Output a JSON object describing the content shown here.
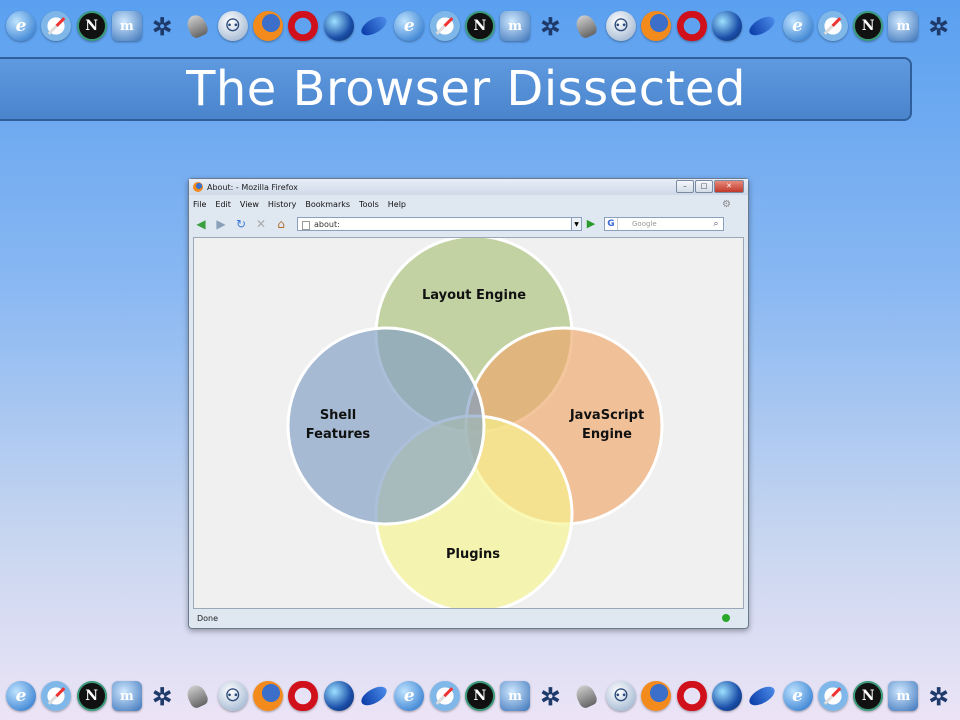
{
  "slide": {
    "title": "The Browser Dissected"
  },
  "icon_strip": {
    "top": [
      "ie-icon",
      "safari-icon",
      "netscape-icon",
      "mozilla-icon",
      "konqueror-icon",
      "ghost-icon",
      "seamonkey-icon",
      "firefox-icon",
      "opera-icon",
      "globe-icon",
      "flock-icon",
      "ie-icon",
      "safari-icon",
      "netscape-icon",
      "mozilla-icon",
      "konqueror-icon",
      "ghost-icon",
      "seamonkey-icon",
      "firefox-icon",
      "opera-icon",
      "globe-icon",
      "flock-icon",
      "ie-icon",
      "safari-icon",
      "netscape-icon",
      "mozilla-icon",
      "konqueror-icon"
    ],
    "bottom": [
      "ie-icon",
      "safari-icon",
      "netscape-icon",
      "mozilla-icon",
      "konqueror-icon",
      "ghost-icon",
      "seamonkey-icon",
      "firefox-icon",
      "opera-icon",
      "globe-icon",
      "flock-icon",
      "ie-icon",
      "safari-icon",
      "netscape-icon",
      "mozilla-icon",
      "konqueror-icon",
      "ghost-icon",
      "seamonkey-icon",
      "firefox-icon",
      "opera-icon",
      "globe-icon",
      "flock-icon",
      "ie-icon",
      "safari-icon",
      "netscape-icon",
      "mozilla-icon",
      "konqueror-icon"
    ]
  },
  "browser": {
    "window_title": "About: - Mozilla Firefox",
    "menu": [
      "File",
      "Edit",
      "View",
      "History",
      "Bookmarks",
      "Tools",
      "Help"
    ],
    "address": "about:",
    "search_placeholder": "Google",
    "search_engine_glyph": "G",
    "status": "Done"
  },
  "diagram": {
    "circles": [
      {
        "label": "Layout Engine",
        "color": "#a9c27a"
      },
      {
        "label": "JavaScript Engine",
        "color": "#f0a86a"
      },
      {
        "label": "Plugins",
        "color": "#f6f48e"
      },
      {
        "label": "Shell Features",
        "color": "#7e9cc4"
      }
    ],
    "label_lines": {
      "layout": [
        "Layout Engine"
      ],
      "javascript": [
        "JavaScript",
        "Engine"
      ],
      "plugins": [
        "Plugins"
      ],
      "shell": [
        "Shell",
        "Features"
      ]
    }
  }
}
